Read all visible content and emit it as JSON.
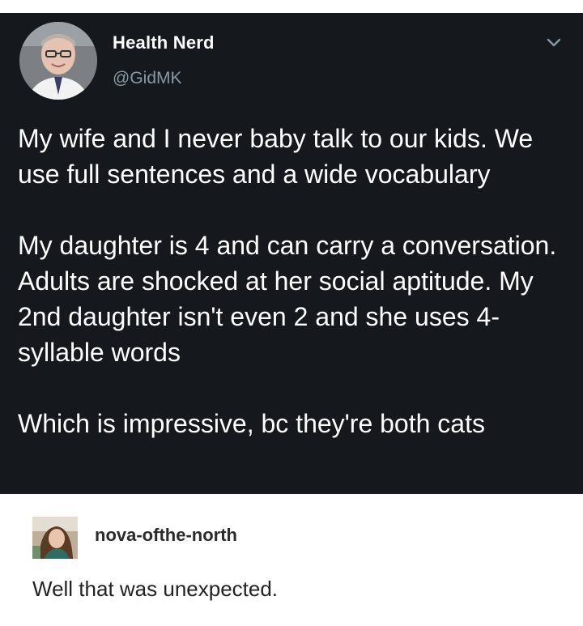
{
  "tweet": {
    "display_name": "Health Nerd",
    "handle": "@GidMK",
    "paragraphs": [
      "My wife and I never baby talk to our kids. We use full sentences and a wide vocabulary",
      "My daughter is 4 and can carry a conversation. Adults are shocked at her social aptitude. My 2nd daughter isn't even 2 and she uses 4-syllable words",
      "Which is impressive, bc they're both cats"
    ],
    "menu_icon": "chevron-down-icon",
    "colors": {
      "background": "#15181c",
      "text": "#ffffff",
      "handle": "#8899a6"
    }
  },
  "reply": {
    "username": "nova-ofthe-north",
    "text": "Well that was unexpected."
  }
}
